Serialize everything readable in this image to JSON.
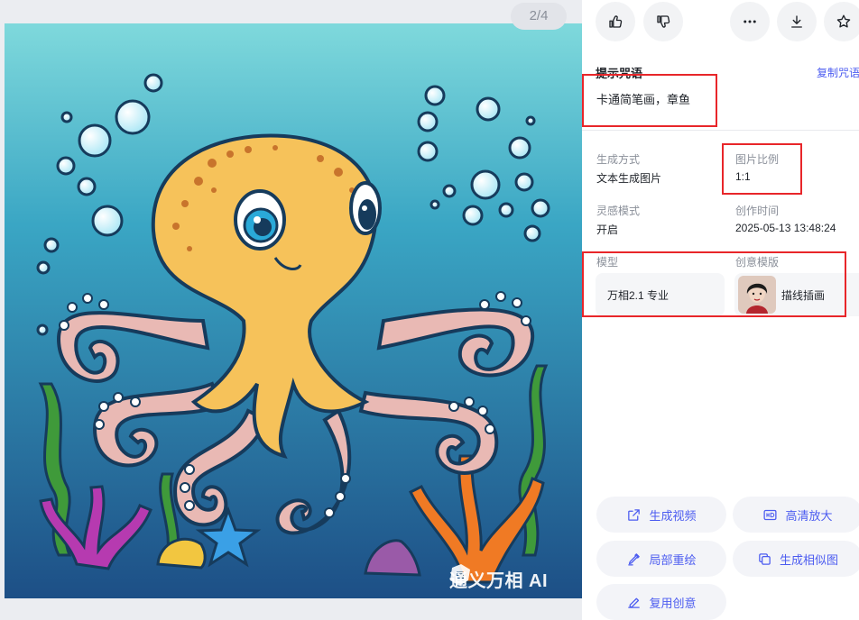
{
  "viewer": {
    "counter": "2/4",
    "watermark": "通义万相 AI"
  },
  "toolbar": {
    "like_icon": "thumbs-up-icon",
    "dislike_icon": "thumbs-down-icon",
    "more_icon": "more-icon",
    "download_icon": "download-icon",
    "favorite_icon": "star-icon"
  },
  "prompt": {
    "title": "提示咒语",
    "copy_label": "复制咒语",
    "text": "卡通简笔画，章鱼"
  },
  "details": {
    "gen_method_label": "生成方式",
    "gen_method_value": "文本生成图片",
    "ratio_label": "图片比例",
    "ratio_value": "1:1",
    "inspire_label": "灵感模式",
    "inspire_value": "开启",
    "time_label": "创作时间",
    "time_value": "2025-05-13 13:48:24",
    "model_label": "模型",
    "model_value": "万相2.1 专业",
    "template_label": "创意模版",
    "template_value": "描线插画"
  },
  "actions": {
    "gen_video": "生成视频",
    "hd_upscale": "高清放大",
    "local_repaint": "局部重绘",
    "gen_similar": "生成相似图",
    "reuse": "复用创意"
  },
  "colors": {
    "accent": "#4c5cf0",
    "highlight": "#e8262a"
  }
}
